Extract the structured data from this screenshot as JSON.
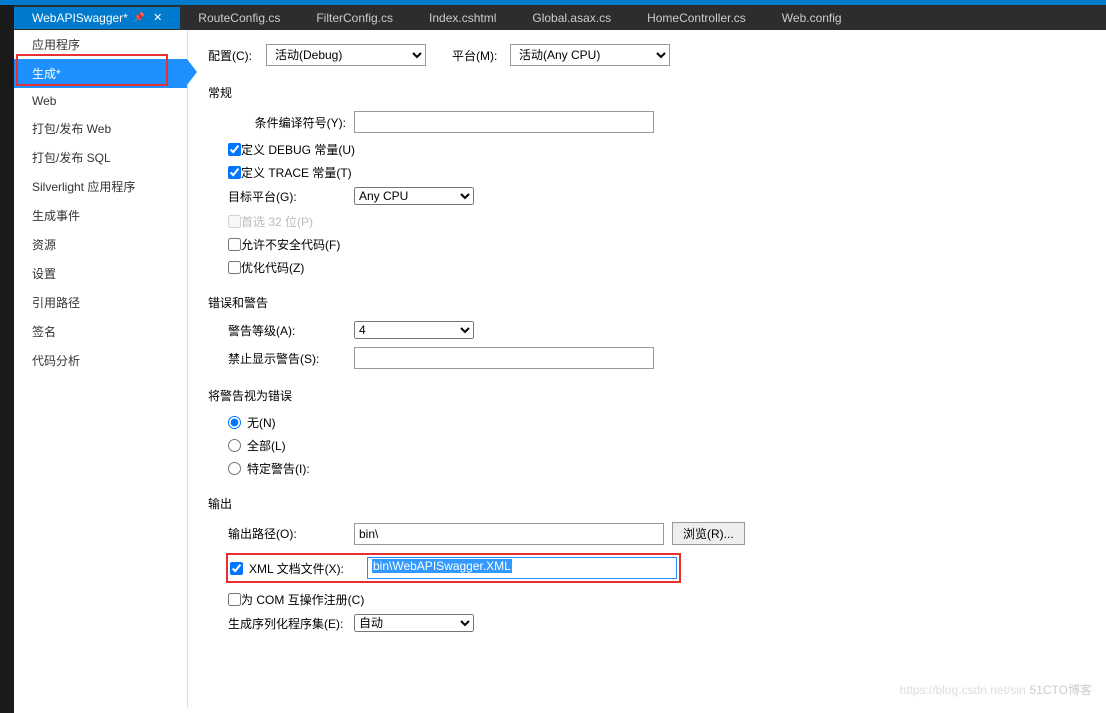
{
  "tabs": [
    {
      "label": "WebAPISwagger*",
      "active": true
    },
    {
      "label": "RouteConfig.cs"
    },
    {
      "label": "FilterConfig.cs"
    },
    {
      "label": "Index.cshtml"
    },
    {
      "label": "Global.asax.cs"
    },
    {
      "label": "HomeController.cs"
    },
    {
      "label": "Web.config"
    }
  ],
  "sidebar": {
    "items": [
      "应用程序",
      "生成*",
      "Web",
      "打包/发布 Web",
      "打包/发布 SQL",
      "Silverlight 应用程序",
      "生成事件",
      "资源",
      "设置",
      "引用路径",
      "签名",
      "代码分析"
    ],
    "activeIndex": 1
  },
  "topbar": {
    "config_label": "配置(C):",
    "config_value": "活动(Debug)",
    "platform_label": "平台(M):",
    "platform_value": "活动(Any CPU)"
  },
  "sections": {
    "general": "常规",
    "errors": "错误和警告",
    "treat_as_err": "将警告视为错误",
    "output": "输出"
  },
  "general": {
    "cond_sym_label": "条件编译符号(Y):",
    "cond_sym_value": "",
    "define_debug": "定义 DEBUG 常量(U)",
    "define_trace": "定义 TRACE 常量(T)",
    "target_platform_label": "目标平台(G):",
    "target_platform_value": "Any CPU",
    "prefer32": "首选 32 位(P)",
    "allow_unsafe": "允许不安全代码(F)",
    "optimize": "优化代码(Z)"
  },
  "errors": {
    "warning_level_label": "警告等级(A):",
    "warning_level_value": "4",
    "suppress_label": "禁止显示警告(S):",
    "suppress_value": ""
  },
  "treat": {
    "none": "无(N)",
    "all": "全部(L)",
    "specific": "特定警告(I):"
  },
  "output": {
    "path_label": "输出路径(O):",
    "path_value": "bin\\",
    "browse": "浏览(R)...",
    "xml_label": "XML 文档文件(X):",
    "xml_value": "bin\\WebAPISwagger.XML",
    "com_label": "为 COM 互操作注册(C)",
    "serial_label": "生成序列化程序集(E):",
    "serial_value": "自动"
  },
  "watermark": {
    "faint": "https://blog.csdn.net/sin",
    "bold": "51CTO博客"
  }
}
